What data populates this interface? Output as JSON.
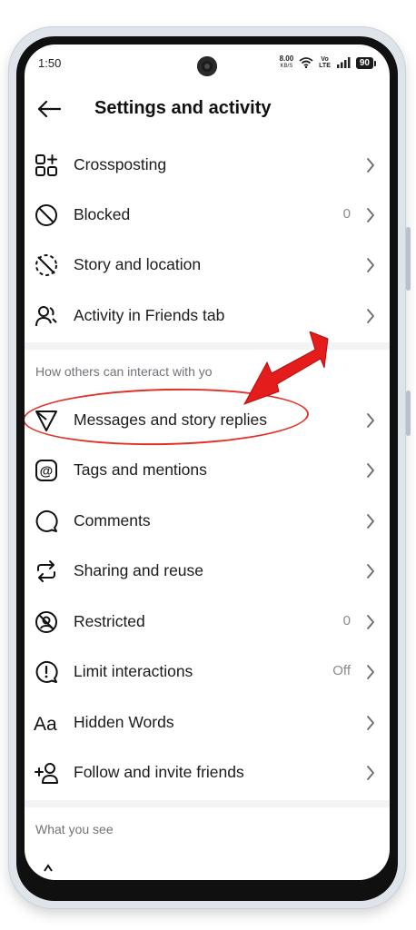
{
  "status_bar": {
    "time": "1:50",
    "network_speed": "8.00",
    "network_unit": "KB/S",
    "volte_top": "Vo",
    "volte_bottom": "LTE",
    "battery": "90"
  },
  "header": {
    "title": "Settings and activity"
  },
  "rows_group1": [
    {
      "label": "Crossposting",
      "value": "",
      "icon": "crossposting-icon"
    },
    {
      "label": "Blocked",
      "value": "0",
      "icon": "blocked-icon"
    },
    {
      "label": "Story and location",
      "value": "",
      "icon": "story-location-icon"
    },
    {
      "label": "Activity in Friends tab",
      "value": "",
      "icon": "friends-activity-icon"
    }
  ],
  "section_interact": "How others can interact with yo",
  "rows_group2": [
    {
      "label": "Messages and story replies",
      "value": "",
      "icon": "messages-icon"
    },
    {
      "label": "Tags and mentions",
      "value": "",
      "icon": "tags-icon"
    },
    {
      "label": "Comments",
      "value": "",
      "icon": "comments-icon"
    },
    {
      "label": "Sharing and reuse",
      "value": "",
      "icon": "sharing-icon"
    },
    {
      "label": "Restricted",
      "value": "0",
      "icon": "restricted-icon"
    },
    {
      "label": "Limit interactions",
      "value": "Off",
      "icon": "limit-icon"
    },
    {
      "label": "Hidden Words",
      "value": "",
      "icon": "hidden-words-icon"
    },
    {
      "label": "Follow and invite friends",
      "value": "",
      "icon": "follow-invite-icon"
    }
  ],
  "section_see": "What you see",
  "annotation_color": "#e23128"
}
